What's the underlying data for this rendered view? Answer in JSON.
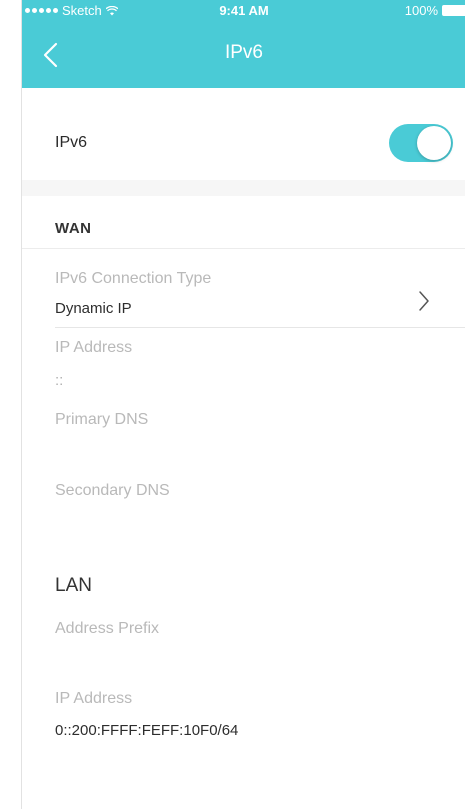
{
  "status_bar": {
    "carrier": "Sketch",
    "time": "9:41 AM",
    "battery": "100%"
  },
  "nav": {
    "title": "IPv6",
    "back_icon": "chevron-left-icon"
  },
  "ipv6_toggle": {
    "label": "IPv6",
    "enabled": true
  },
  "wan": {
    "title": "WAN",
    "connection_type_label": "IPv6 Connection Type",
    "connection_type_value": "Dynamic IP",
    "ip_address_label": "IP Address",
    "ip_address_value": "::",
    "primary_dns_label": "Primary DNS",
    "secondary_dns_label": "Secondary DNS"
  },
  "lan": {
    "title": "LAN",
    "address_prefix_label": "Address Prefix",
    "ip_address_label": "IP Address",
    "ip_address_value": "0::200:FFFF:FEFF:10F0/64"
  },
  "colors": {
    "accent": "#4acbd6"
  }
}
